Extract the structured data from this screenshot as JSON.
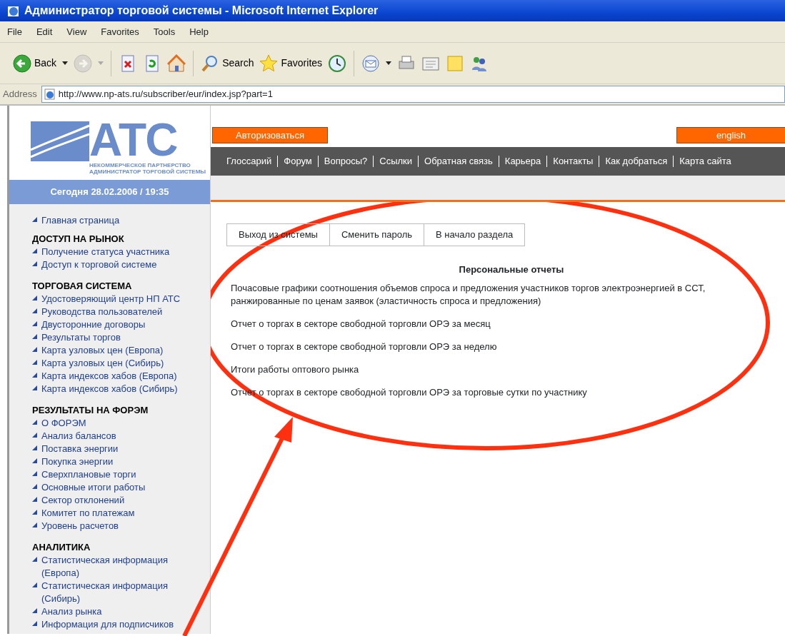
{
  "window": {
    "title": "Администратор торговой системы - Microsoft Internet Explorer"
  },
  "menu": [
    "File",
    "Edit",
    "View",
    "Favorites",
    "Tools",
    "Help"
  ],
  "toolbar": [
    {
      "kind": "back",
      "label": "Back",
      "disabled": false,
      "dropdown": true
    },
    {
      "kind": "forward",
      "disabled": true,
      "dropdown": true
    },
    {
      "kind": "stop",
      "disabled": false
    },
    {
      "kind": "refresh",
      "disabled": false
    },
    {
      "kind": "home",
      "disabled": false
    },
    {
      "kind": "search",
      "label": "Search",
      "disabled": false
    },
    {
      "kind": "favorites",
      "label": "Favorites",
      "disabled": false
    },
    {
      "kind": "history",
      "disabled": false
    },
    {
      "kind": "mail",
      "disabled": false,
      "dropdown": true
    },
    {
      "kind": "print",
      "disabled": false
    },
    {
      "kind": "edit",
      "disabled": false
    },
    {
      "kind": "note",
      "disabled": false
    },
    {
      "kind": "messenger",
      "disabled": false
    }
  ],
  "address": {
    "label": "Address",
    "value": "http://www.np-ats.ru/subscriber/eur/index.jsp?part=1"
  },
  "logo": {
    "mark": "АТС",
    "line_1": "НЕКОММЕРЧЕСКОЕ ПАРТНЕРСТВО",
    "line_2": "АДМИНИСТРАТОР ТОРГОВОЙ СИСТЕМЫ"
  },
  "date": "Сегодня 28.02.2006 / 19:35",
  "login_button": "Авторизоваться",
  "language_button": "english",
  "top_nav": [
    "Глоссарий",
    "Форум",
    "Вопросы?",
    "Ссылки",
    "Обратная связь",
    "Карьера",
    "Контакты",
    "Как добраться",
    "Карта сайта"
  ],
  "sidebar": {
    "home": "Главная страница",
    "sections": [
      {
        "title": "ДОСТУП НА РЫНОК",
        "items": [
          "Получение статуса участника",
          "Доступ к торговой системе"
        ]
      },
      {
        "title": "ТОРГОВАЯ СИСТЕМА",
        "items": [
          "Удостоверяющий центр НП АТС",
          "Руководства пользователей",
          "Двусторонние договоры",
          "Результаты торгов",
          "Карта узловых цен (Европа)",
          "Карта узловых цен (Сибирь)",
          "Карта индексов хабов (Европа)",
          "Карта индексов хабов (Сибирь)"
        ]
      },
      {
        "title": "РЕЗУЛЬТАТЫ НА ФОРЭМ",
        "items": [
          "О ФОРЭМ",
          "Анализ балансов",
          "Поставка энергии",
          "Покупка энергии",
          "Сверхплановые торги",
          "Основные итоги работы",
          "Сектор отклонений",
          "Комитет по платежам",
          "Уровень расчетов"
        ]
      },
      {
        "title": "АНАЛИТИКА",
        "items": [
          "Статистическая информация (Европа)",
          "Статистическая информация (Сибирь)",
          "Анализ рынка",
          "Информация для подписчиков"
        ]
      }
    ]
  },
  "actions": [
    "Выход из системы",
    "Сменить пароль",
    "В начало раздела"
  ],
  "reports": {
    "title": "Персональные отчеты",
    "links": [
      "Почасовые графики соотношения объемов спроса и предложения участников торгов электроэнергией в ССТ, ранжированные по ценам заявок (эластичность спроса и предложения)",
      "Отчет о торгах в секторе свободной торговли ОРЭ за месяц",
      "Отчет о торгах в секторе свободной торговли ОРЭ за неделю",
      "Итоги работы оптового рынка",
      "Отчет о торгах в секторе свободной торговли ОРЭ за торговые сутки по участнику"
    ]
  }
}
